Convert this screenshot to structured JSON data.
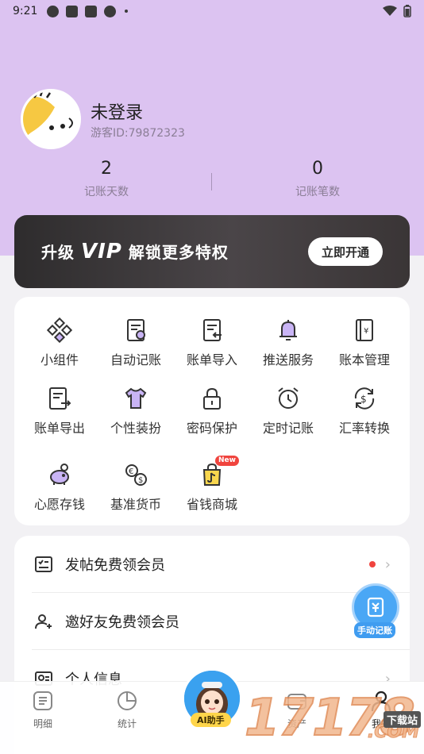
{
  "status_bar": {
    "time": "9:21"
  },
  "profile": {
    "username": "未登录",
    "guest_id": "游客ID:79872323"
  },
  "stats": [
    {
      "value": "2",
      "label": "记账天数"
    },
    {
      "value": "0",
      "label": "记账笔数"
    }
  ],
  "vip_banner": {
    "prefix": "升级",
    "vip": "VIP",
    "suffix": "解锁更多特权",
    "button": "立即开通"
  },
  "features": [
    {
      "label": "小组件",
      "icon": "widget-icon"
    },
    {
      "label": "自动记账",
      "icon": "auto-bookkeeping-icon"
    },
    {
      "label": "账单导入",
      "icon": "bill-import-icon"
    },
    {
      "label": "推送服务",
      "icon": "bell-icon"
    },
    {
      "label": "账本管理",
      "icon": "ledger-icon"
    },
    {
      "label": "账单导出",
      "icon": "bill-export-icon"
    },
    {
      "label": "个性装扮",
      "icon": "tshirt-icon"
    },
    {
      "label": "密码保护",
      "icon": "lock-icon"
    },
    {
      "label": "定时记账",
      "icon": "alarm-clock-icon"
    },
    {
      "label": "汇率转换",
      "icon": "exchange-rate-icon"
    },
    {
      "label": "心愿存钱",
      "icon": "piggy-bank-icon"
    },
    {
      "label": "基准货币",
      "icon": "currency-icon"
    },
    {
      "label": "省钱商城",
      "icon": "shopping-bag-icon",
      "badge": "New"
    }
  ],
  "list_items": [
    {
      "label": "发帖免费领会员",
      "icon": "checklist-icon",
      "has_dot": true
    },
    {
      "label": "邀好友免费领会员",
      "icon": "invite-user-icon",
      "has_dot": false
    },
    {
      "label": "个人信息",
      "icon": "profile-info-icon",
      "has_dot": false
    }
  ],
  "fab": {
    "label": "手动记账"
  },
  "tabs": [
    {
      "label": "明细",
      "icon": "detail-icon"
    },
    {
      "label": "统计",
      "icon": "chart-icon"
    },
    {
      "label": "AI助手",
      "icon": "ai-assistant-avatar"
    },
    {
      "label": "资产",
      "icon": "wallet-icon"
    },
    {
      "label": "我的",
      "icon": "person-icon"
    }
  ],
  "watermark": {
    "digits": "17178",
    "domain": ".COM",
    "tag": "下载站"
  },
  "colors": {
    "hero": "#dcc3f1",
    "accent": "#4aa7f5",
    "badge": "#f0443e"
  }
}
